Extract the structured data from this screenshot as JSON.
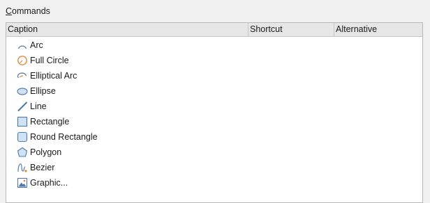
{
  "group": {
    "mnemonic": "C",
    "rest": "ommands"
  },
  "columns": {
    "caption": "Caption",
    "shortcut": "Shortcut",
    "alternative": "Alternative"
  },
  "commands": [
    {
      "caption": "Arc",
      "icon": "arc-icon",
      "shortcut": "",
      "alternative": ""
    },
    {
      "caption": "Full Circle",
      "icon": "full-circle-icon",
      "shortcut": "",
      "alternative": ""
    },
    {
      "caption": "Elliptical Arc",
      "icon": "elliptical-arc-icon",
      "shortcut": "",
      "alternative": ""
    },
    {
      "caption": "Ellipse",
      "icon": "ellipse-icon",
      "shortcut": "",
      "alternative": ""
    },
    {
      "caption": "Line",
      "icon": "line-icon",
      "shortcut": "",
      "alternative": ""
    },
    {
      "caption": "Rectangle",
      "icon": "rectangle-icon",
      "shortcut": "",
      "alternative": ""
    },
    {
      "caption": "Round Rectangle",
      "icon": "round-rectangle-icon",
      "shortcut": "",
      "alternative": ""
    },
    {
      "caption": "Polygon",
      "icon": "polygon-icon",
      "shortcut": "",
      "alternative": ""
    },
    {
      "caption": "Bezier",
      "icon": "bezier-icon",
      "shortcut": "",
      "alternative": ""
    },
    {
      "caption": "Graphic...",
      "icon": "graphic-icon",
      "shortcut": "",
      "alternative": ""
    }
  ],
  "colors": {
    "icon_blue": "#5b8fc7",
    "icon_fill": "#cfe3f5",
    "icon_orange": "#e08a3c",
    "frame_border": "#b8b8b8",
    "header_bg": "#e6e6e6"
  }
}
